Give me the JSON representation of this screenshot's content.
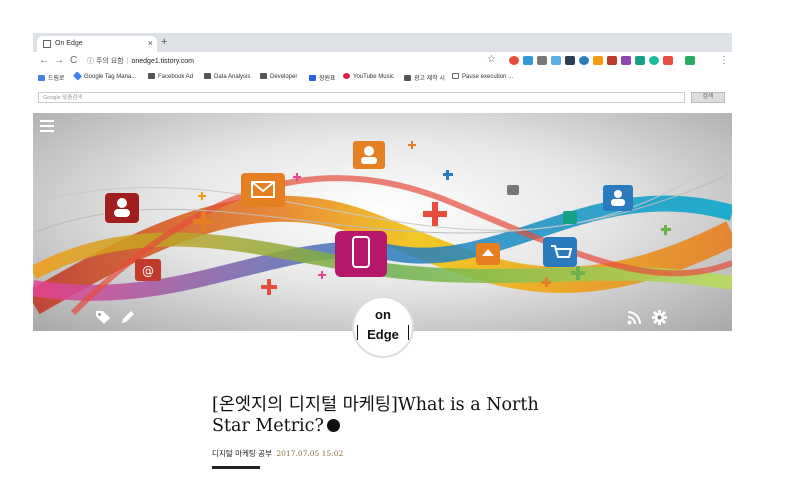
{
  "browser": {
    "tab_title": "On Edge",
    "tab_close": "×",
    "new_tab": "+",
    "nav": {
      "back": "←",
      "forward": "→",
      "reload": "C"
    },
    "url_security": "ⓘ 주의 요함",
    "url_host": "onedge1.tistory.com",
    "star": "☆",
    "bookmarks": [
      {
        "label": "드림로"
      },
      {
        "label": "Google Tag Mana..."
      },
      {
        "label": "Facebook Ad"
      },
      {
        "label": "Data Analysis"
      },
      {
        "label": "Developer"
      },
      {
        "label": "장원표"
      },
      {
        "label": "YouTube Music"
      },
      {
        "label": "광고 제작 시"
      },
      {
        "label": "Pause execution ..."
      }
    ]
  },
  "search": {
    "placeholder": "Google 맞춤검색",
    "button": "검색"
  },
  "colors": {
    "accent_red": "#c0392b",
    "accent_orange": "#e67e22",
    "accent_blue": "#2a7bbd",
    "accent_green": "#6ab04c",
    "accent_yellow": "#f1c40f",
    "accent_magenta": "#b5176b",
    "date_color": "#8a6a3a"
  },
  "hero": {
    "icons": [
      "menu-icon",
      "tag-icon",
      "pencil-icon",
      "rss-icon",
      "gear-icon"
    ]
  },
  "logo": {
    "line1": "on",
    "line2": "Edge"
  },
  "post": {
    "title": "[온엣지의 디지털 마케팅]What is a North Star Metric?",
    "category": "디지털 마케팅 공부",
    "date": "2017.07.05 15:02"
  }
}
